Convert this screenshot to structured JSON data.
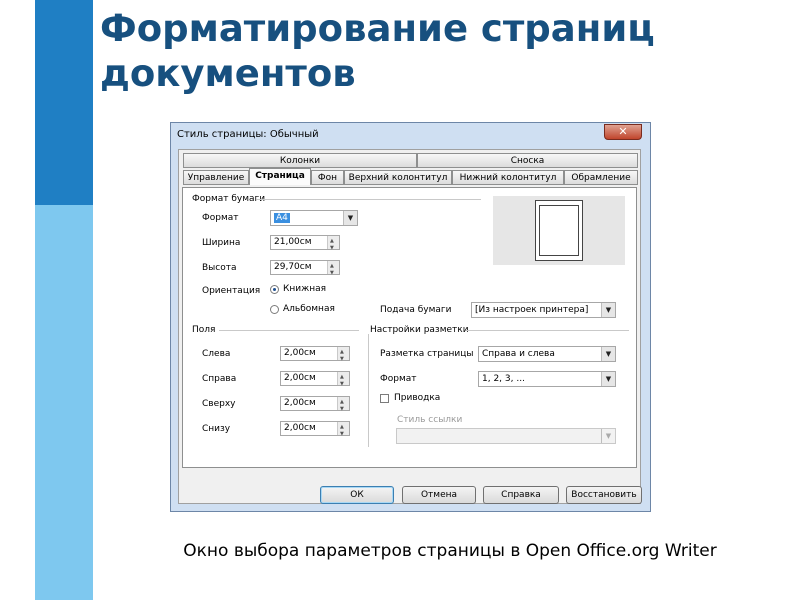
{
  "slide": {
    "title": "Форматирование страниц документов",
    "caption": "Окно выбора параметров страницы в Open Office.org Writer",
    "colors": {
      "bar_dark": "#1f7fc4",
      "bar_light": "#7ec8ef",
      "title": "#17507f"
    }
  },
  "dialog": {
    "title": "Стиль страницы: Обычный",
    "close_glyph": "✕",
    "tabs_row1": [
      "Колонки",
      "Сноска"
    ],
    "tabs_row2": [
      "Управление",
      "Страница",
      "Фон",
      "Верхний колонтитул",
      "Нижний колонтитул",
      "Обрамление"
    ],
    "active_tab": "Страница",
    "paper_format": {
      "section": "Формат бумаги",
      "format_label": "Формат",
      "format_value": "A4",
      "width_label": "Ширина",
      "width_value": "21,00см",
      "height_label": "Высота",
      "height_value": "29,70см",
      "orientation_label": "Ориентация",
      "portrait_label": "Книжная",
      "landscape_label": "Альбомная",
      "orientation_selected": "portrait",
      "paper_tray_label": "Подача бумаги",
      "paper_tray_value": "[Из настроек принтера]"
    },
    "margins": {
      "section": "Поля",
      "left_label": "Слева",
      "left_value": "2,00см",
      "right_label": "Справа",
      "right_value": "2,00см",
      "top_label": "Сверху",
      "top_value": "2,00см",
      "bottom_label": "Снизу",
      "bottom_value": "2,00см"
    },
    "layout": {
      "section": "Настройки разметки",
      "page_layout_label": "Разметка страницы",
      "page_layout_value": "Справа и слева",
      "format_label": "Формат",
      "format_value": "1, 2, 3, ...",
      "register_label": "Приводка",
      "register_checked": false,
      "reference_style_label": "Стиль ссылки",
      "reference_style_value": ""
    },
    "buttons": {
      "ok": "ОК",
      "cancel": "Отмена",
      "help": "Справка",
      "reset": "Восстановить"
    }
  }
}
